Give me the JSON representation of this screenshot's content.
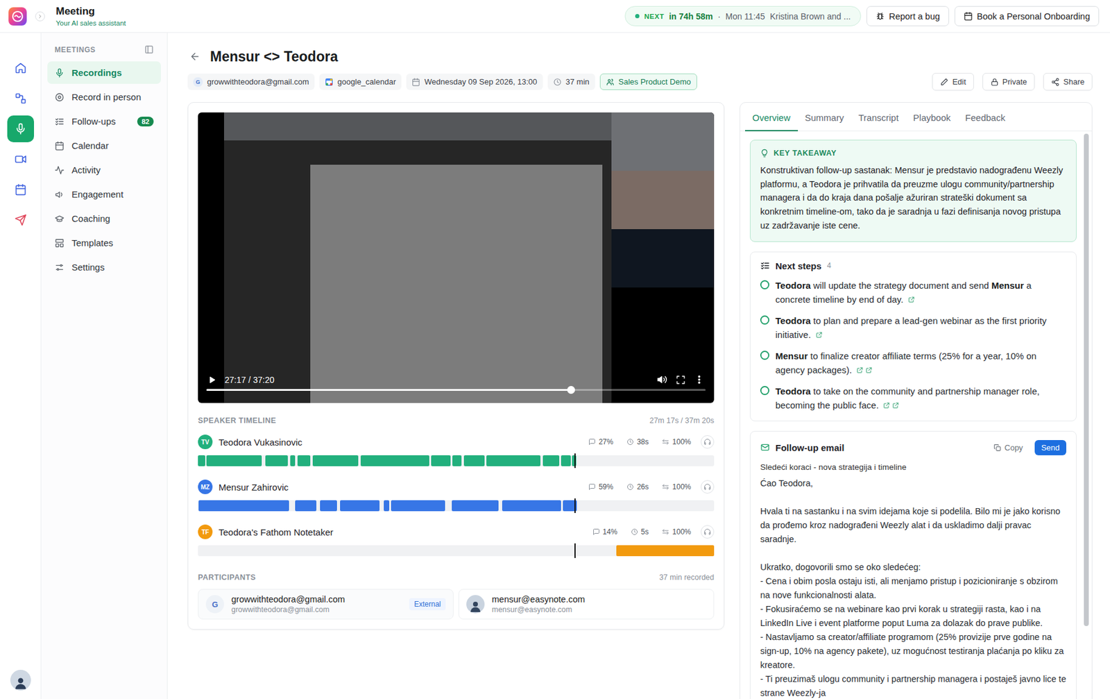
{
  "app": {
    "title": "Meeting",
    "subtitle": "Your AI sales assistant"
  },
  "next": {
    "label": "NEXT",
    "countdown": "in 74h 58m",
    "separator": "·",
    "when": "Mon 11:45",
    "who": "Kristina Brown and ..."
  },
  "header_buttons": [
    "Report a bug",
    "Book a Personal Onboarding"
  ],
  "rail": [
    {
      "selected": false
    },
    {
      "selected": false
    },
    {
      "selected": true
    },
    {
      "selected": false
    },
    {
      "selected": false
    },
    {
      "selected": false
    }
  ],
  "sidebar": {
    "heading": "MEETINGS",
    "items": [
      {
        "label": "Recordings",
        "selected": true,
        "badge": ""
      },
      {
        "label": "Record in person",
        "selected": false,
        "badge": ""
      },
      {
        "label": "Follow-ups",
        "selected": false,
        "badge": "82"
      },
      {
        "label": "Calendar",
        "selected": false,
        "badge": ""
      },
      {
        "label": "Activity",
        "selected": false,
        "badge": ""
      },
      {
        "label": "Engagement",
        "selected": false,
        "badge": ""
      },
      {
        "label": "Coaching",
        "selected": false,
        "badge": ""
      },
      {
        "label": "Templates",
        "selected": false,
        "badge": ""
      },
      {
        "label": "Settings",
        "selected": false,
        "badge": ""
      }
    ]
  },
  "meeting": {
    "title": "Mensur <> Teodora",
    "meta": [
      {
        "kind": "organizer",
        "avatar": "G",
        "text": "growwithteodora@gmail.com"
      },
      {
        "kind": "source",
        "avatar": "",
        "text": "google_calendar"
      },
      {
        "kind": "date",
        "avatar": "",
        "text": "Wednesday 09 Sep 2026, 13:00"
      },
      {
        "kind": "duration",
        "avatar": "",
        "text": "37 min"
      },
      {
        "kind": "type",
        "avatar": "",
        "text": "Sales Product Demo"
      }
    ],
    "actions": [
      "Edit",
      "Private",
      "Share"
    ]
  },
  "video": {
    "time": "27:17 / 37:20",
    "level": 0.73,
    "playing": false
  },
  "timeline": {
    "heading": "SPEAKER TIMELINE",
    "position": "27m 17s / 37m 20s",
    "playhead": 0.731,
    "speakers": [
      {
        "initials": "TV",
        "name": "Teodora Vukasinovic",
        "color": "#22b07d",
        "talk": "27%",
        "monologue": "38s",
        "share": "100%",
        "segments": [
          [
            0,
            1.4
          ],
          [
            1.6,
            12.3
          ],
          [
            13.0,
            17.4
          ],
          [
            17.9,
            18.8
          ],
          [
            19.3,
            21.8
          ],
          [
            22.2,
            31.1
          ],
          [
            31.5,
            44.8
          ],
          [
            45.2,
            48.9
          ],
          [
            49.3,
            51.1
          ],
          [
            51.5,
            55.5
          ],
          [
            55.9,
            66.4
          ],
          [
            66.8,
            70.0
          ],
          [
            70.4,
            72.2
          ],
          [
            72.5,
            73.3
          ]
        ]
      },
      {
        "initials": "MZ",
        "name": "Mensur Zahirovic",
        "color": "#3776e6",
        "talk": "59%",
        "monologue": "26s",
        "share": "100%",
        "segments": [
          [
            0.1,
            17.7
          ],
          [
            18.8,
            22.9
          ],
          [
            23.6,
            27.0
          ],
          [
            27.5,
            35.2
          ],
          [
            36.0,
            37.0
          ],
          [
            37.4,
            47.9
          ],
          [
            49.2,
            58.2
          ],
          [
            58.9,
            70.3
          ],
          [
            70.7,
            73.4
          ]
        ]
      },
      {
        "initials": "TF",
        "name": "Teodora's Fathom Notetaker",
        "color": "#f29a0e",
        "talk": "14%",
        "monologue": "5s",
        "share": "100%",
        "segments": [
          [
            81.0,
            100
          ]
        ]
      }
    ]
  },
  "participants": {
    "heading": "PARTICIPANTS",
    "recorded": "37 min recorded",
    "items": [
      {
        "kind": "initial",
        "avatar": "G",
        "name": "growwithteodora@gmail.com",
        "email": "growwithteodora@gmail.com",
        "tag": "External"
      },
      {
        "kind": "photo",
        "avatar": "",
        "name": "mensur@easynote.com",
        "email": "mensur@easynote.com",
        "tag": ""
      }
    ]
  },
  "panel": {
    "tabs": [
      {
        "label": "Overview",
        "selected": true
      },
      {
        "label": "Summary",
        "selected": false
      },
      {
        "label": "Transcript",
        "selected": false
      },
      {
        "label": "Playbook",
        "selected": false
      },
      {
        "label": "Feedback",
        "selected": false
      }
    ],
    "takeaway": {
      "heading": "KEY TAKEAWAY",
      "text": "Konstruktivan follow-up sastanak: Mensur je predstavio nadograđenu Weezly platformu, a Teodora je prihvatila da preuzme ulogu community/partnership managera i da do kraja dana pošalje ažuriran strateški dokument sa konkretnim timeline-om, tako da je saradnja u fazi definisanja novog pristupa uz zadržavanje iste cene."
    },
    "next_steps": {
      "heading": "Next steps",
      "count": "4",
      "items": [
        {
          "done": false,
          "links": 1,
          "parts": [
            {
              "t": "Teodora",
              "b": true
            },
            {
              "t": " will update the strategy document and send ",
              "b": false
            },
            {
              "t": "Mensur",
              "b": true
            },
            {
              "t": " a concrete timeline by end of day.",
              "b": false
            }
          ]
        },
        {
          "done": false,
          "links": 1,
          "parts": [
            {
              "t": "Teodora",
              "b": true
            },
            {
              "t": " to plan and prepare a lead-gen webinar as the first priority initiative.",
              "b": false
            }
          ]
        },
        {
          "done": false,
          "links": 2,
          "parts": [
            {
              "t": "Mensur",
              "b": true
            },
            {
              "t": " to finalize creator affiliate terms (25% for a year, 10% on agency packages).",
              "b": false
            }
          ]
        },
        {
          "done": false,
          "links": 2,
          "parts": [
            {
              "t": "Teodora",
              "b": true
            },
            {
              "t": " to take on the community and partnership manager role, becoming the public face.",
              "b": false
            }
          ]
        }
      ]
    },
    "email": {
      "heading": "Follow-up email",
      "copy": "Copy",
      "send": "Send",
      "subject": "Sledeći koraci - nova strategija i timeline",
      "greeting": "Ćao Teodora,",
      "paragraph": "Hvala ti na sastanku i na svim idejama koje si podelila. Bilo mi je jako korisno da prođemo kroz nadograđeni Weezly alat i da uskladimo dalji pravac saradnje.",
      "intro": "Ukratko, dogovorili smo se oko sledećeg:",
      "bullets": [
        "- Cena i obim posla ostaju isti, ali menjamo pristup i pozicioniranje s obzirom na nove funkcionalnosti alata.",
        "- Fokusiraćemo se na webinare kao prvi korak u strategiji rasta, kao i na LinkedIn Live i event platforme poput Luma za dolazak do prave publike.",
        "- Nastavljamo sa creator/affiliate programom (25% provizije prve godine na sign-up, 10% na agency pakete), uz mogućnost testiranja plaćanja po kliku za kreatore.",
        "- Ti preuzimaš ulogu community i partnership managera i postaješ javno lice te strane Weezly-ja"
      ]
    }
  }
}
